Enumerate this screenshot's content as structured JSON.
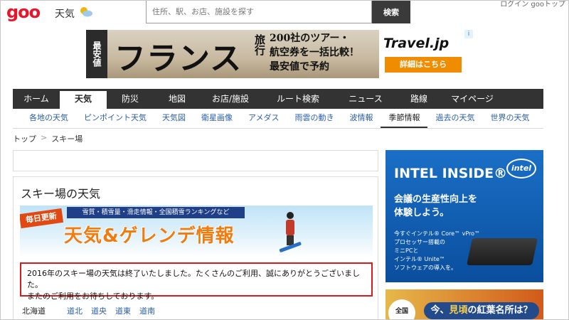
{
  "header": {
    "logo": "goo",
    "section_label": "天気",
    "search_placeholder": "住所、駅、お店、施設を探す",
    "search_button": "検索",
    "top_links": "ログイン  gooトップ"
  },
  "ad_top": {
    "cheap_label": "最安値",
    "headline": "フランス",
    "headline_sub": "旅行",
    "copy_line1": "200社のツアー・",
    "copy_line2": "航空券を一括比較！",
    "copy_line3": "最安値で予約",
    "brand": "Travel.jp",
    "cta": "詳細はこちら",
    "ad_marker": "i"
  },
  "main_nav": [
    {
      "label": "ホーム"
    },
    {
      "label": "天気",
      "active": true
    },
    {
      "label": "防災"
    },
    {
      "label": "地図"
    },
    {
      "label": "お店/施設"
    },
    {
      "label": "ルート検索"
    },
    {
      "label": "ニュース"
    },
    {
      "label": "路線"
    },
    {
      "label": "マイページ"
    }
  ],
  "sub_nav": [
    {
      "label": "各地の天気"
    },
    {
      "label": "ピンポイント天気"
    },
    {
      "label": "天気図"
    },
    {
      "label": "衛星画像"
    },
    {
      "label": "アメダス"
    },
    {
      "label": "雨雲の動き"
    },
    {
      "label": "波情報"
    },
    {
      "label": "季節情報",
      "active": true
    },
    {
      "label": "過去の天気"
    },
    {
      "label": "世界の天気"
    }
  ],
  "breadcrumb": {
    "home": "トップ",
    "separator": ">",
    "current": "スキー場"
  },
  "content": {
    "title": "スキー場の天気",
    "banner": {
      "badge": "毎日更新",
      "topline": "雪質・積雪量・滑走情報・全国積雪ランキングなど",
      "headline": "天気&ゲレンデ情報"
    },
    "notice_line1": "2016年のスキー場の天気は終了いたしました。たくさんのご利用、誠にありがとうございました。",
    "notice_line2": "またのご利用をお待ちしております。",
    "region_label": "北海道",
    "regions": [
      "道北",
      "道央",
      "道東",
      "道南"
    ]
  },
  "ad_intel": {
    "title": "INTEL INSIDE®",
    "logo": "intel",
    "lead_line1": "会議の生産性向上を",
    "lead_line2": "体験しよう。",
    "small_line1": "今すぐインテル® Core™ vPro™",
    "small_line2": "プロセッサー搭載の",
    "small_line3": "ミニPCと",
    "small_line4": "インテル® Unite™",
    "small_line5": "ソフトウェアの導入を。"
  },
  "ad_autumn": {
    "badge": "全国",
    "text_prefix": "今、",
    "text_highlight": "見頃",
    "text_suffix": "の紅葉名所は？"
  },
  "colors": {
    "brand_red": "#e8162b",
    "nav_dark": "#333333",
    "link_blue": "#2b5ea8",
    "notice_red": "#d61c1c"
  }
}
